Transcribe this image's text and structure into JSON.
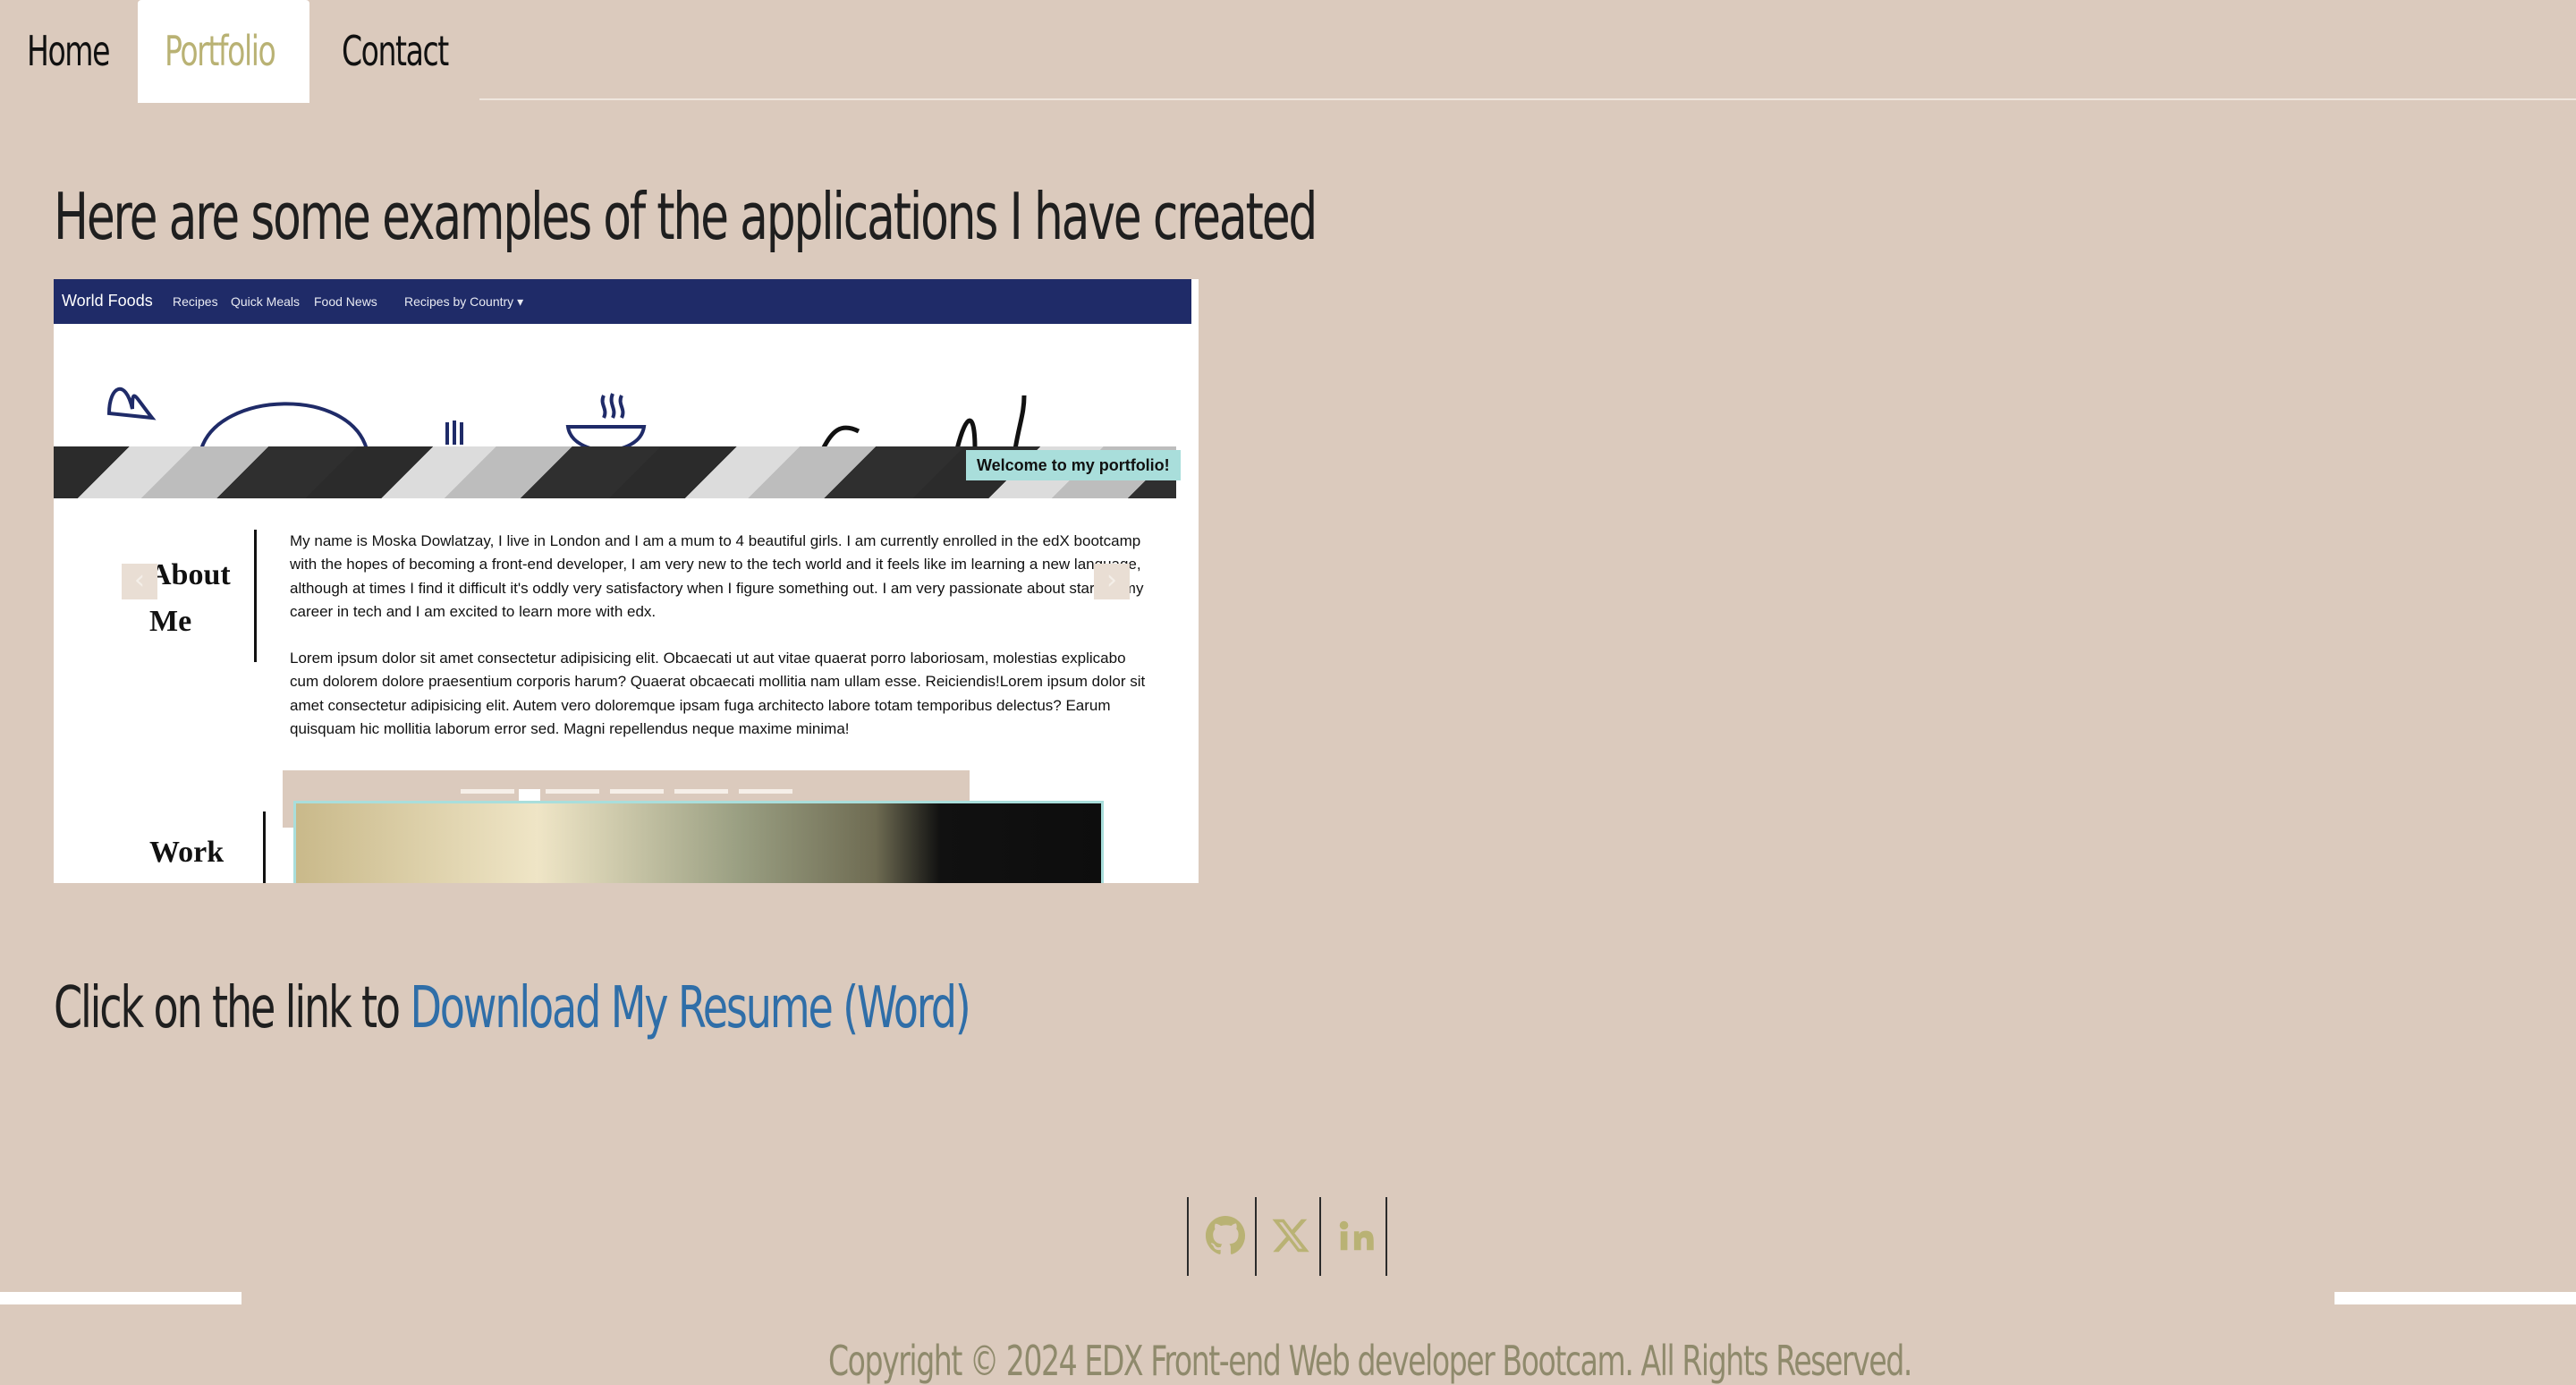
{
  "nav": {
    "tabs": [
      {
        "label": "Home",
        "active": false
      },
      {
        "label": "Portfolio",
        "active": true
      },
      {
        "label": "Contact",
        "active": false
      }
    ]
  },
  "main": {
    "heading": "Here are some examples of the applications I have created",
    "carousel": {
      "site": {
        "brand": "World Foods",
        "links": [
          "Recipes",
          "Quick Meals",
          "Food News",
          "Recipes by Country"
        ],
        "dropdown_caret": "▾",
        "welcome": "Welcome to my portfolio!",
        "about_title": "About Me",
        "about_p1": "My name is Moska Dowlatzay, I live in London and I am a mum to 4 beautiful girls. I am currently enrolled in the edX bootcamp with the hopes of becoming a front-end developer, I am very new to the tech world and it feels like im learning a new language, although at times I find it difficult it's oddly very satisfactory when I figure something out. I am very passionate about starting my career in tech and I am excited to learn more with edx.",
        "about_p2": "Lorem ipsum dolor sit amet consectetur adipisicing elit. Obcaecati ut aut vitae quaerat porro laboriosam, molestias explicabo cum dolorem dolore praesentium corporis harum? Quaerat obcaecati mollitia nam ullam esse. Reiciendis!Lorem ipsum dolor sit amet consectetur adipisicing elit. Autem vero doloremque ipsam fuga architecto labore totam temporibus delectus? Earum quisquam hic mollitia laborum error sed. Magni repellendus neque maxime minima!",
        "work_title": "Work"
      },
      "prev_glyph": "‹",
      "next_glyph": "›",
      "slide_count": 6,
      "active_slide": 2
    },
    "resume": {
      "prefix": "Click on the link to ",
      "link_text": "Download My Resume (Word)"
    }
  },
  "social": {
    "icons": [
      "github-icon",
      "x-twitter-icon",
      "linkedin-icon"
    ],
    "color": "#b9b274"
  },
  "footer": {
    "copyright": "Copyright © 2024 EDX Front-end Web developer Bootcam. All Rights Reserved."
  },
  "colors": {
    "background": "#dbcabd",
    "active_tab_text": "#b9b274",
    "link": "#2f6ea8",
    "site_nav": "#1f2b68",
    "welcome_badge": "#a9dedb"
  }
}
